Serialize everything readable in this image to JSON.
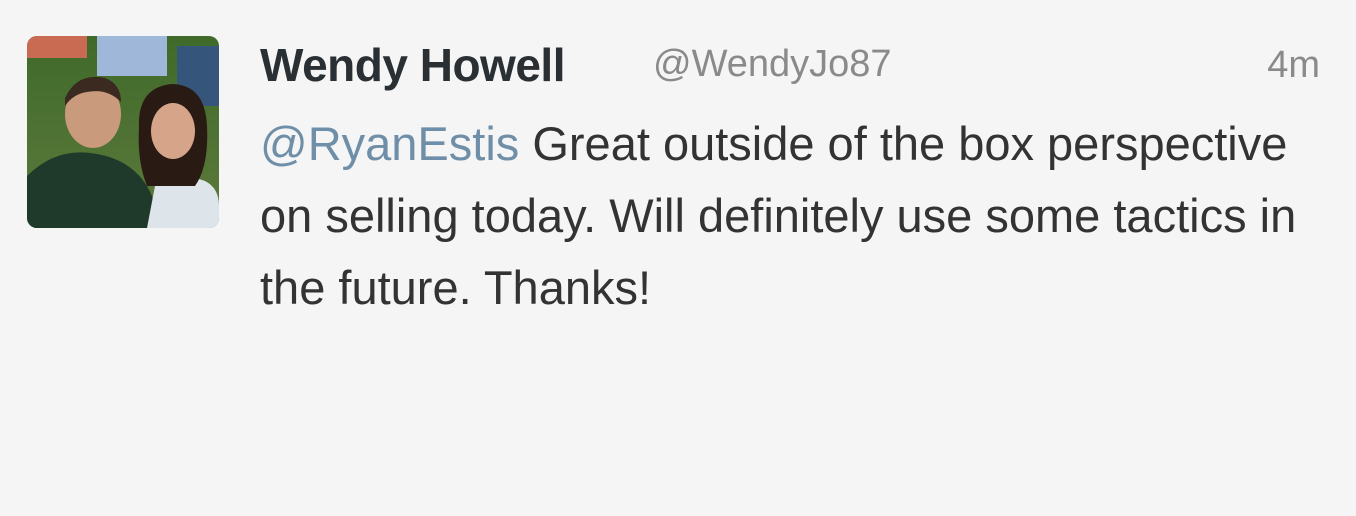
{
  "tweet": {
    "author": {
      "display_name": "Wendy Howell",
      "username": "@WendyJo87",
      "avatar_icon": "profile-photo"
    },
    "timestamp": "4m",
    "mention": "@RyanEstis",
    "body": " Great outside of the box perspective on selling today. Will definitely use some tactics in the future. Thanks!",
    "colors": {
      "background": "#f5f5f5",
      "name": "#292f33",
      "text": "#333333",
      "meta": "#8a8a8a",
      "link": "#6f8fa8"
    }
  }
}
